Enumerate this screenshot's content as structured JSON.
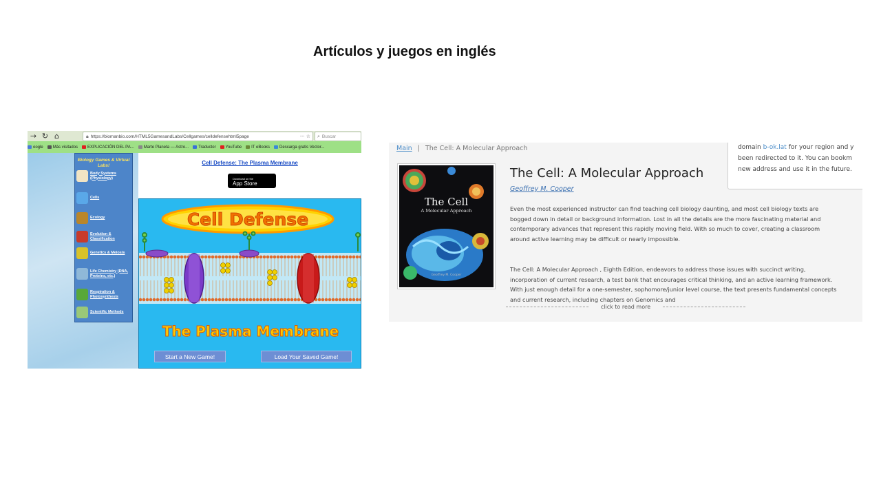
{
  "slide": {
    "title": "Artículos y juegos en inglés"
  },
  "browser": {
    "url": "https://biomanbio.com/HTML5GamesandLabs/Cellgames/celldefensehtml5page",
    "search_placeholder": "Buscar",
    "bookmarks": [
      {
        "label": "oogle",
        "color": "#4a7bd6"
      },
      {
        "label": "Más visitados",
        "color": "#555555"
      },
      {
        "label": "EXPLICACIÓN DEL PA...",
        "color": "#e02020"
      },
      {
        "label": "Marte Planeta — Astro...",
        "color": "#888888"
      },
      {
        "label": "Traductor",
        "color": "#3a6fd8"
      },
      {
        "label": "YouTube",
        "color": "#e02020"
      },
      {
        "label": "IT eBooks",
        "color": "#6a8a3a"
      },
      {
        "label": "Descarga gratis Vector...",
        "color": "#3a8ad8"
      }
    ]
  },
  "game_site": {
    "sidebar_title": "Biology Games & Virtual Labs!",
    "menu": [
      {
        "label": "Body Systems (Physiology)",
        "icon": "body-systems-icon",
        "color": "#f1e4c4"
      },
      {
        "label": "Cells",
        "icon": "cell-icon",
        "color": "#5aa8e8"
      },
      {
        "label": "Ecology",
        "icon": "ecology-icon",
        "color": "#b9862a"
      },
      {
        "label": "Evolution & Classification",
        "icon": "evolution-icon",
        "color": "#c83a2a"
      },
      {
        "label": "Genetics & Meiosis",
        "icon": "genetics-icon",
        "color": "#d8c22a"
      },
      {
        "label": "Life Chemistry (DNA, Proteins, etc.)",
        "icon": "dna-icon",
        "color": "#8fb8d8"
      },
      {
        "label": "Respiration & Photosynthesis",
        "icon": "leaf-icon",
        "color": "#58a83a"
      },
      {
        "label": "Scientific Methods",
        "icon": "microscope-icon",
        "color": "#9ac878"
      }
    ],
    "page_link": "Cell Defense: The Plasma Membrane",
    "app_store": {
      "small": "Download on the",
      "big": "App Store"
    },
    "game_title": "Cell Defense",
    "game_subtitle": "The Plasma Membrane",
    "buttons": {
      "new_game": "Start a New Game!",
      "load_game": "Load Your Saved Game!"
    }
  },
  "book_page": {
    "breadcrumb": {
      "main": "Main",
      "separator": "|",
      "current": "The Cell: A Molecular Approach"
    },
    "title": "The Cell: A Molecular Approach",
    "author": "Geoffrey M. Cooper",
    "cover": {
      "title": "The Cell",
      "subtitle": "A Molecular Approach",
      "author": "Geoffrey M. Cooper"
    },
    "description_1": "Even the most experienced instructor can find teaching cell biology daunting, and most cell biology texts are bogged down in detail or background information. Lost in all the details are the more fascinating material and contemporary advances that represent this rapidly moving field. With so much to cover, creating a classroom around active learning may be difficult or nearly impossible.",
    "description_2": "The Cell: A Molecular Approach , Eighth Edition, endeavors to address those issues with succinct writing, incorporation of current research, a test bank that encourages critical thinking, and an active learning framework. With just enough detail for a one-semester, sophomore/junior level course, the text presents fundamental concepts and current research, including chapters on Genomics and",
    "read_more": "click to read more",
    "notice": {
      "line1_pre": "domain ",
      "line1_link": "b-ok.lat",
      "line1_post": " for your region and y",
      "line2": "been redirected to it. You can bookm",
      "line3": "new address and use it in the future."
    }
  }
}
